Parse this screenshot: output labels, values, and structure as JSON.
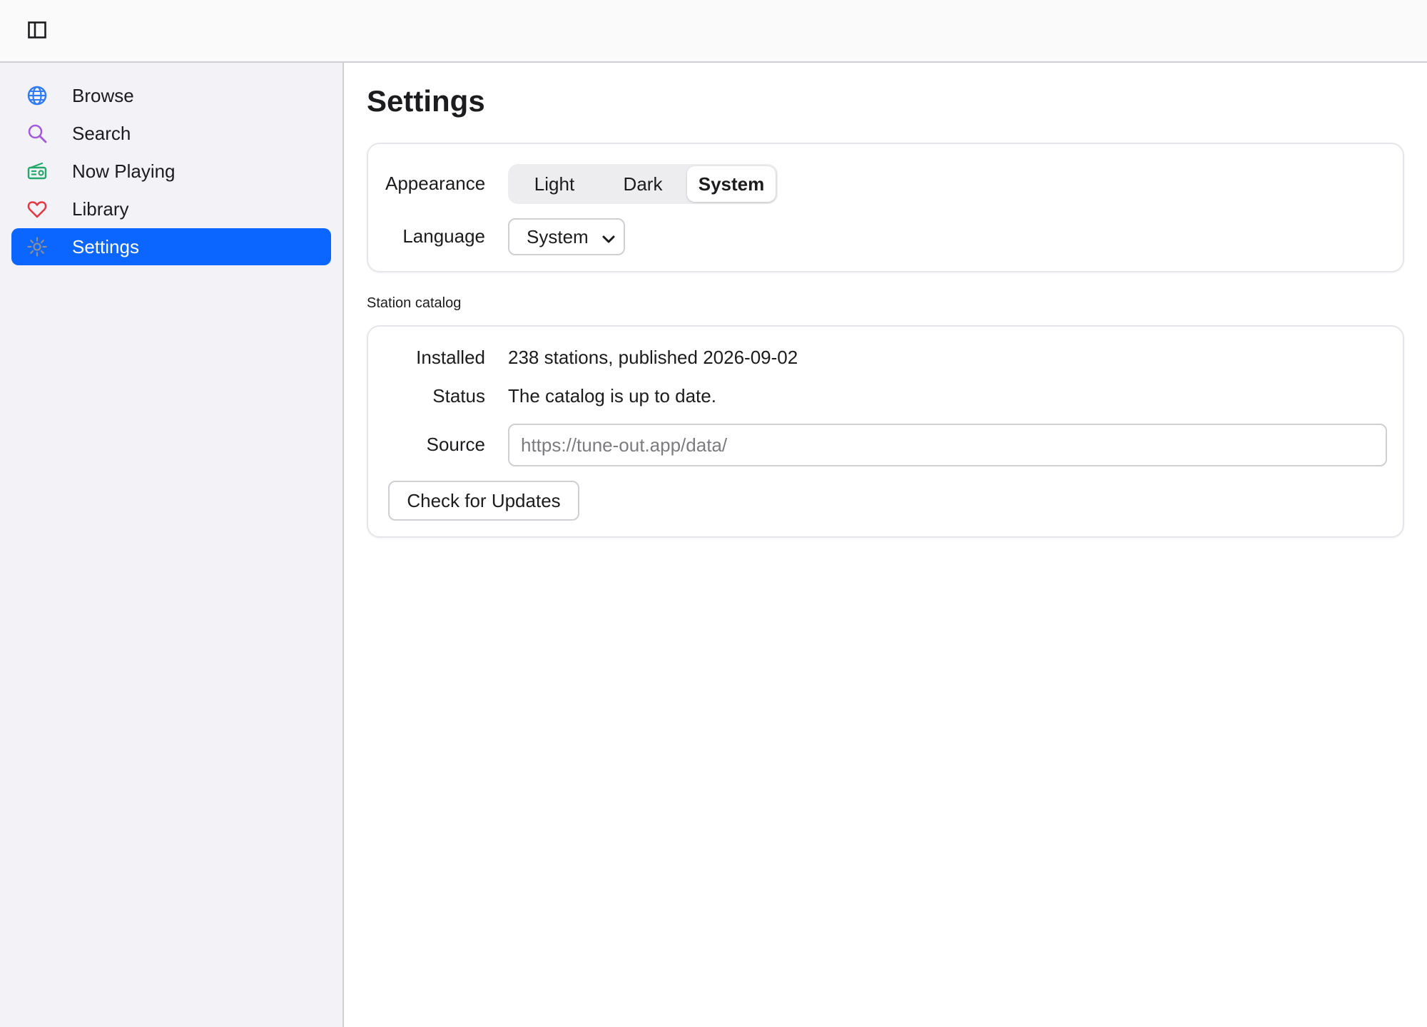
{
  "toolbar": {
    "toggle_icon": "sidebar-toggle-icon"
  },
  "sidebar": {
    "items": [
      {
        "label": "Browse",
        "icon": "globe-icon",
        "color": "#2f7bf5",
        "active": false
      },
      {
        "label": "Search",
        "icon": "search-icon",
        "color": "#a35ad9",
        "active": false
      },
      {
        "label": "Now Playing",
        "icon": "radio-icon",
        "color": "#26a86c",
        "active": false
      },
      {
        "label": "Library",
        "icon": "heart-icon",
        "color": "#e5373f",
        "active": false
      },
      {
        "label": "Settings",
        "icon": "gear-icon",
        "color": "#8e8e93",
        "active": true
      }
    ],
    "active_color": "#0a66ff"
  },
  "main": {
    "title": "Settings",
    "appearance": {
      "label": "Appearance",
      "options": [
        "Light",
        "Dark",
        "System"
      ],
      "selected": "System"
    },
    "language": {
      "label": "Language",
      "value": "System"
    },
    "catalog": {
      "section_title": "Station catalog",
      "installed_label": "Installed",
      "installed_value": "238 stations, published 2026-09-02",
      "status_label": "Status",
      "status_value": "The catalog is up to date.",
      "source_label": "Source",
      "source_placeholder": "https://tune-out.app/data/",
      "source_value": "",
      "check_button": "Check for Updates"
    }
  }
}
